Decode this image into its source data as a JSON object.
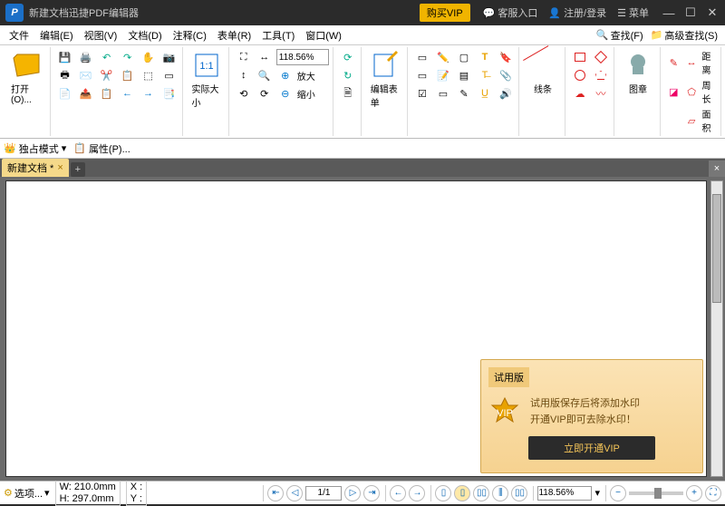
{
  "titlebar": {
    "title": "新建文档迅捷PDF编辑器",
    "buy_vip": "购买VIP",
    "support": "客服入口",
    "login": "注册/登录",
    "menu": "菜单"
  },
  "menu": {
    "file": "文件",
    "edit": "编辑(E)",
    "view": "视图(V)",
    "document": "文档(D)",
    "comment": "注释(C)",
    "form": "表单(R)",
    "tools": "工具(T)",
    "window": "窗口(W)",
    "find": "查找(F)",
    "advfind": "高级查找(S)"
  },
  "toolbar": {
    "open": "打开(O)...",
    "actual": "实际大小",
    "zoomin": "放大",
    "zoomout": "缩小",
    "editform": "编辑表单",
    "lines": "线条",
    "stamp": "图章",
    "distance": "距离",
    "perimeter": "周长",
    "area": "面积",
    "zoomval": "118.56%"
  },
  "secondbar": {
    "exclusive": "独占模式",
    "properties": "属性(P)..."
  },
  "tabs": {
    "doc1": "新建文档 *"
  },
  "trial": {
    "header": "试用版",
    "line1": "试用版保存后将添加水印",
    "line2": "开通VIP即可去除水印！",
    "cta": "立即开通VIP"
  },
  "status": {
    "options": "选项...",
    "w": "W:  210.0mm",
    "h": "H:  297.0mm",
    "x": "X :",
    "y": "Y :",
    "page": "1/1",
    "zoom": "118.56%"
  }
}
